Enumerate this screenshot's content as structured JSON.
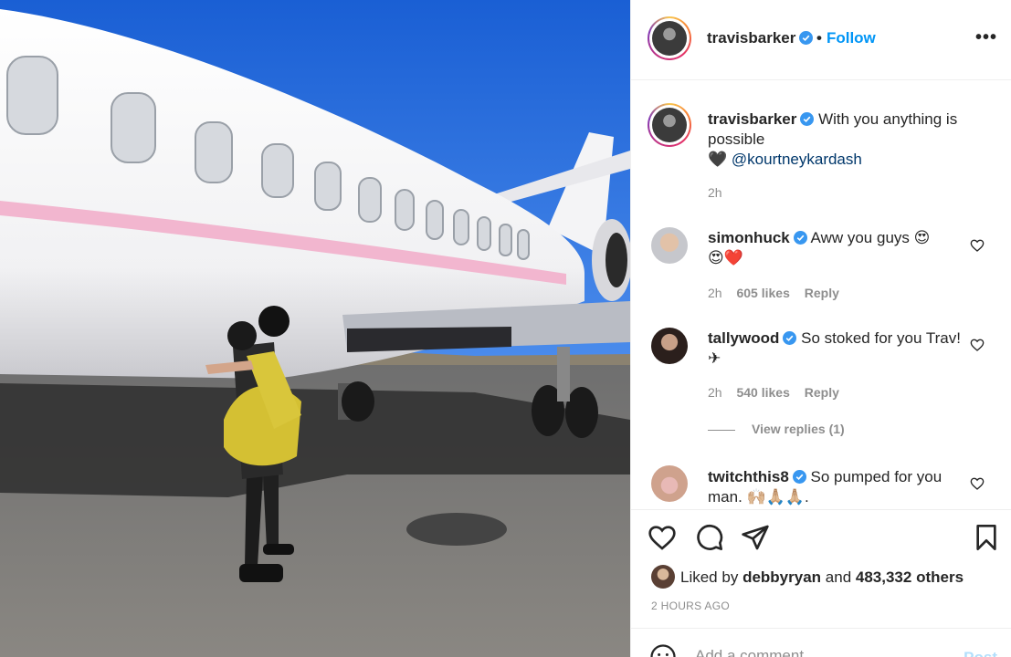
{
  "post": {
    "author": "travisbarker",
    "follow_dot": "•",
    "follow_label": "Follow",
    "more_label": "•••",
    "caption": {
      "username": "travisbarker",
      "text": "With you anything is possible",
      "heart": "🖤",
      "mention": "@kourtneykardash",
      "time": "2h"
    },
    "comments": [
      {
        "username": "simonhuck",
        "text": "Aww you guys 😍",
        "emoji_line": "😍",
        "heart_emoji": "❤️",
        "time": "2h",
        "likes": "605 likes",
        "reply": "Reply"
      },
      {
        "username": "tallywood",
        "text": "So stoked for you Trav! ✈",
        "time": "2h",
        "likes": "540 likes",
        "reply": "Reply"
      },
      {
        "username": "twitchthis8",
        "text": "So pumped for you man. 🙌🏼🙏🏼🙏🏼."
      }
    ],
    "view_replies": "View replies (1)",
    "liked_by_prefix": "Liked by",
    "liked_by_user": "debbyryan",
    "liked_by_and": "and",
    "liked_by_count": "483,332 others",
    "posted_ago": "2 HOURS AGO",
    "add_comment_placeholder": "Add a comment…",
    "post_button": "Post"
  },
  "icons": {
    "verified": "verified-badge-icon",
    "like": "heart-icon",
    "comment": "comment-bubble-icon",
    "share": "paper-plane-icon",
    "save": "bookmark-icon",
    "emoji": "smiley-icon"
  },
  "colors": {
    "accent": "#0095f6",
    "verified": "#3897f0",
    "muted": "#8e8e8e",
    "text": "#262626",
    "divider": "#efefef"
  }
}
